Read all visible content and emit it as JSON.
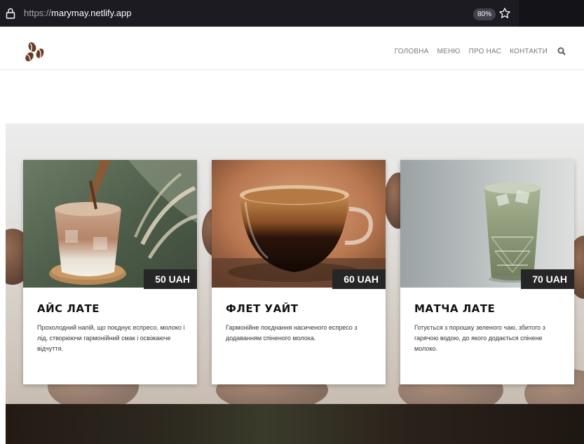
{
  "browser": {
    "url_scheme": "https://",
    "url_host": "marymay.netlify.app",
    "zoom": "80%"
  },
  "nav": {
    "items": [
      "ГОЛОВНА",
      "МЕНЮ",
      "ПРО НАС",
      "КОНТАКТИ"
    ]
  },
  "cards": [
    {
      "title": "АЙС ЛАТЕ",
      "price": "50 UAH",
      "description": "Прохолодний напій, що поєднує еспресо, молоко і лід, створюючи гармонійний смак і освіжаюче відчуття."
    },
    {
      "title": "ФЛЕТ УАЙТ",
      "price": "60 UAH",
      "description": "Гармонійне поєднання насиченого еспресо з додаванням спіненого молока."
    },
    {
      "title": "МАТЧА ЛАТЕ",
      "price": "70 UAH",
      "description": "Готується з порошку зеленого чаю, збитого з гарячою водою, до якого додається спінене молоко."
    }
  ],
  "colors": {
    "browser_bg": "#1c1b22",
    "price_badge": "#262626",
    "logo_brown": "#6b3a22"
  },
  "icons": [
    "lock-icon",
    "star-icon",
    "logo-beans-icon",
    "search-icon"
  ]
}
